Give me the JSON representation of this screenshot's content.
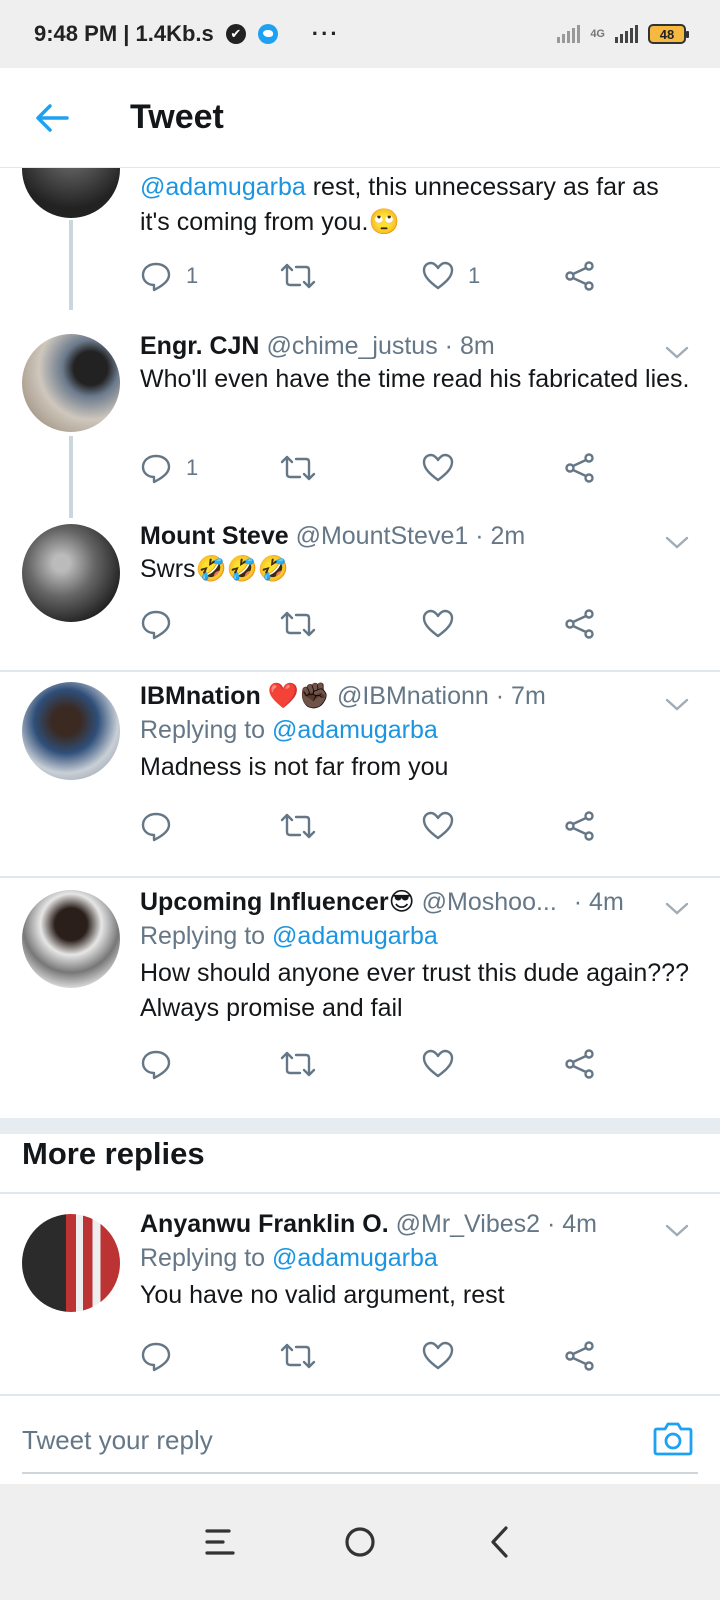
{
  "status_bar": {
    "time_speed": "9:48 PM | 1.4Kb.s",
    "more": "···",
    "network": "4G",
    "battery": "48"
  },
  "header": {
    "title": "Tweet"
  },
  "tweets": [
    {
      "text_mention": "@adamugarba",
      "text_rest": " rest, this unnecessary as far as it's coming from you.🙄",
      "reply_count": "1",
      "like_count": "1"
    },
    {
      "name": "Engr. CJN",
      "handle": "@chime_justus",
      "time": "· 8m",
      "text": "Who'll even have the time read his fabricated lies.",
      "reply_count": "1"
    },
    {
      "name": "Mount Steve",
      "handle": "@MountSteve1",
      "time": "· 2m",
      "text": "Swrs🤣🤣🤣"
    },
    {
      "name": "IBMnation ❤️✊🏿",
      "handle": "@IBMnationn",
      "time": "· 7m",
      "replying_label": "Replying to ",
      "replying_to": "@adamugarba",
      "text": "Madness is not far from you"
    },
    {
      "name": "Upcoming Influencer😎",
      "handle": "@Moshoo...",
      "time": "· 4m",
      "replying_label": "Replying to ",
      "replying_to": "@adamugarba",
      "text": "How should anyone ever trust this dude again??? Always promise and fail"
    }
  ],
  "more_replies": {
    "title": "More replies",
    "tweet": {
      "name": "Anyanwu Franklin O.",
      "handle": "@Mr_Vibes2",
      "time": "· 4m",
      "replying_label": "Replying to ",
      "replying_to": "@adamugarba",
      "text": "You have no valid argument, rest"
    }
  },
  "reply_box": {
    "placeholder": "Tweet your reply"
  },
  "colors": {
    "accent": "#1da1f2",
    "mention": "#1b95e0",
    "secondary_text": "#657786",
    "divider": "#e1e8ed"
  }
}
